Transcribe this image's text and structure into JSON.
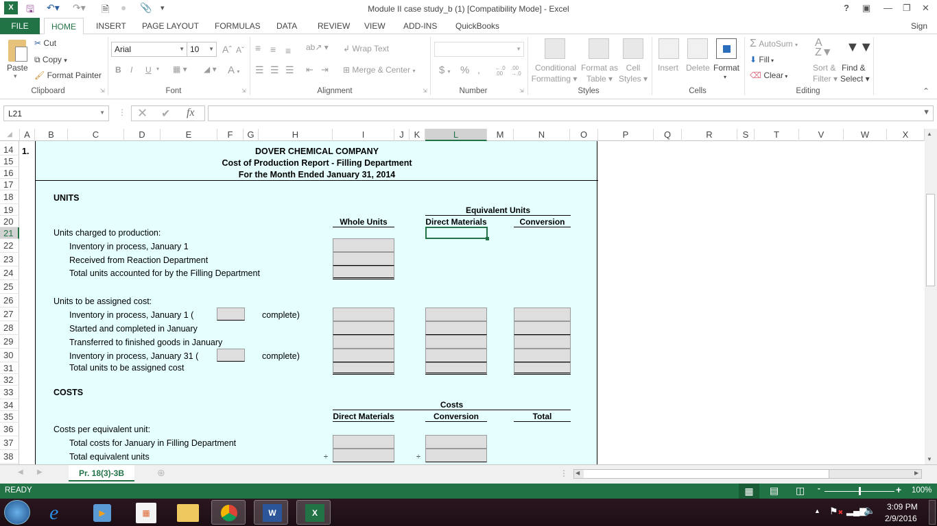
{
  "window": {
    "title": "Module II case study_b (1)  [Compatibility Mode] - Excel",
    "controls": [
      "?",
      "ribbon-display",
      "minimize",
      "restore",
      "close"
    ],
    "sign_in": "Sign in"
  },
  "quick_access": {
    "icons": [
      "excel-logo-icon",
      "save-icon",
      "undo-icon",
      "redo-icon",
      "print-preview-icon",
      "circle-icon",
      "attach-icon",
      "customize-icon"
    ]
  },
  "tabs": [
    {
      "label": "FILE"
    },
    {
      "label": "HOME",
      "active": true
    },
    {
      "label": "INSERT"
    },
    {
      "label": "PAGE LAYOUT"
    },
    {
      "label": "FORMULAS"
    },
    {
      "label": "DATA"
    },
    {
      "label": "REVIEW"
    },
    {
      "label": "VIEW"
    },
    {
      "label": "ADD-INS"
    },
    {
      "label": "QuickBooks"
    }
  ],
  "ribbon": {
    "clipboard": {
      "label": "Clipboard",
      "paste": "Paste",
      "cut": "Cut",
      "copy": "Copy",
      "format_painter": "Format Painter"
    },
    "font": {
      "label": "Font",
      "font_name": "Arial",
      "font_size": "10",
      "bold": "B",
      "italic": "I",
      "underline": "U",
      "font_color": "A"
    },
    "alignment": {
      "label": "Alignment",
      "wrap_text": "Wrap Text",
      "merge_center": "Merge & Center"
    },
    "number": {
      "label": "Number",
      "format": "",
      "currency": "$",
      "percent": "%",
      "comma": ",",
      "inc_dec": "←.0 .00",
      "dec_dec": ".00 →.0"
    },
    "styles": {
      "label": "Styles",
      "conditional_formatting": [
        "Conditional",
        "Formatting ▾"
      ],
      "format_as_table": [
        "Format as",
        "Table ▾"
      ],
      "cell_styles": [
        "Cell",
        "Styles ▾"
      ]
    },
    "cells": {
      "label": "Cells",
      "insert": "Insert",
      "delete": "Delete",
      "format": "Format"
    },
    "editing": {
      "label": "Editing",
      "autosum": "AutoSum",
      "fill": "Fill",
      "clear": "Clear",
      "sort_filter": [
        "Sort &",
        "Filter ▾"
      ],
      "find_select": [
        "Find &",
        "Select ▾"
      ]
    }
  },
  "formula_bar": {
    "name_box": "L21",
    "cancel": "✕",
    "enter": "✔",
    "fx": "fx",
    "formula": ""
  },
  "columns": [
    "A",
    "B",
    "C",
    "D",
    "E",
    "F",
    "G",
    "H",
    "I",
    "J",
    "K",
    "L",
    "M",
    "N",
    "O",
    "P",
    "Q",
    "R",
    "S",
    "T",
    "V",
    "W",
    "X"
  ],
  "selected_column": "L",
  "rows": [
    "14",
    "15",
    "16",
    "17",
    "18",
    "19",
    "20",
    "21",
    "22",
    "23",
    "24",
    "25",
    "26",
    "27",
    "28",
    "29",
    "30",
    "31",
    "32",
    "33",
    "34",
    "35",
    "36",
    "37",
    "38"
  ],
  "selected_row": "21",
  "sheet": {
    "item_number": "1.",
    "company": "DOVER CHEMICAL COMPANY",
    "report_title": "Cost of Production Report - Filling Department",
    "period": "For the Month Ended January 31, 2014",
    "units_heading": "UNITS",
    "equivalent_units": "Equivalent Units",
    "col_whole_units": "Whole Units",
    "col_direct_materials": "Direct Materials",
    "col_conversion": "Conversion",
    "units_charged": "Units charged to production:",
    "inv_jan1": "Inventory in process, January 1",
    "received": "Received from Reaction Department",
    "total_accounted": "Total units accounted for by the Filling Department",
    "units_assigned": "Units to be assigned cost:",
    "inv_jan1_pct": "Inventory in process, January 1   (",
    "complete": "complete)",
    "started_completed": "Started and completed in January",
    "transferred": "Transferred to finished goods in January",
    "inv_jan31_pct": "Inventory in process, January 31 (",
    "total_assigned": "Total units to be assigned cost",
    "costs_heading": "COSTS",
    "costs_label": "Costs",
    "col_total": "Total",
    "cost_per_eu": "Costs per equivalent unit:",
    "total_costs_jan": "Total costs for January in Filling Department",
    "total_eu": "Total equivalent units",
    "divide": "÷"
  },
  "sheet_tabs": [
    {
      "label": "Pr. 18(3)-3B",
      "active": true
    }
  ],
  "status": {
    "mode": "READY",
    "zoom": "100%",
    "zoom_fraction": 0.5
  },
  "taskbar": {
    "apps": [
      "start-button",
      "internet-explorer",
      "media-player",
      "metro-apps",
      "file-explorer",
      "chrome",
      "word",
      "excel"
    ],
    "time": "3:09 PM",
    "date": "2/9/2016"
  }
}
